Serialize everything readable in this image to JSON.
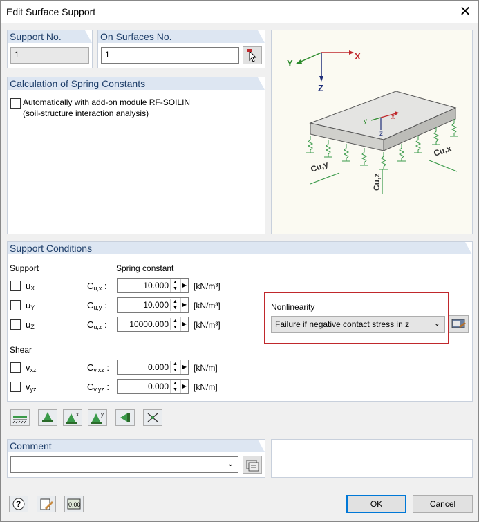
{
  "window": {
    "title": "Edit Surface Support"
  },
  "support_no": {
    "label": "Support No.",
    "value": "1"
  },
  "on_surfaces": {
    "label": "On Surfaces No.",
    "value": "1"
  },
  "spring_calc": {
    "title": "Calculation of Spring Constants",
    "option_line1": "Automatically with add-on module RF-SOILIN",
    "option_line2": "(soil-structure interaction analysis)"
  },
  "diagram": {
    "axis_x": "X",
    "axis_y": "Y",
    "axis_z": "Z",
    "local_x": "x",
    "local_y": "y",
    "local_z": "z",
    "c_uy": "Cu,y",
    "c_ux": "Cu,x",
    "c_uz": "Cu,z"
  },
  "support_conditions": {
    "title": "Support Conditions",
    "support_label": "Support",
    "spring_label": "Spring constant",
    "shear_label": "Shear",
    "rows": [
      {
        "dof": "u",
        "sub": "X",
        "clabel": "C",
        "csub": "u,x",
        "value": "10.000",
        "unit": "[kN/m³]"
      },
      {
        "dof": "u",
        "sub": "Y",
        "clabel": "C",
        "csub": "u,y",
        "value": "10.000",
        "unit": "[kN/m³]"
      },
      {
        "dof": "u",
        "sub": "Z",
        "clabel": "C",
        "csub": "u,z",
        "value": "10000.000",
        "unit": "[kN/m³]"
      },
      {
        "dof": "v",
        "sub": "xz",
        "clabel": "C",
        "csub": "v,xz",
        "value": "0.000",
        "unit": "[kN/m]"
      },
      {
        "dof": "v",
        "sub": "yz",
        "clabel": "C",
        "csub": "v,yz",
        "value": "0.000",
        "unit": "[kN/m]"
      }
    ],
    "colon": ":",
    "nonlinearity": {
      "label": "Nonlinearity",
      "value": "Failure if negative contact stress in z"
    }
  },
  "comment": {
    "label": "Comment",
    "value": ""
  },
  "buttons": {
    "ok": "OK",
    "cancel": "Cancel"
  },
  "colors": {
    "accent": "#0078d7",
    "highlight": "#c0282c",
    "panel_header": "#dde6f2"
  }
}
